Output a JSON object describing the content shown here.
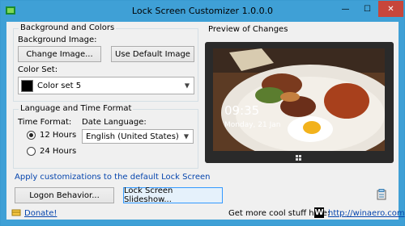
{
  "window": {
    "title": "Lock Screen Customizer 1.0.0.0",
    "minimize": "—",
    "maximize": "☐",
    "close": "✕",
    "app_icon": "lock-screen-app-icon"
  },
  "background_group": {
    "legend": "Background and Colors",
    "background_label": "Background Image:",
    "change_image_button": "Change Image...",
    "default_image_button": "Use Default Image",
    "color_set_label": "Color Set:",
    "color_set_value": "Color set 5",
    "color_swatch": "#000000"
  },
  "preview_group": {
    "legend": "Preview of Changes",
    "time": "09:35",
    "date": "Monday, 21 Jan"
  },
  "language_group": {
    "legend": "Language and Time Format",
    "time_format_label": "Time Format:",
    "option_12": "12 Hours",
    "option_24": "24 Hours",
    "selected_time_format": "12 Hours",
    "date_language_label": "Date Language:",
    "date_language_value": "English (United States)"
  },
  "apply_link": "Apply customizations to the default Lock Screen",
  "logon_button": "Logon Behavior...",
  "slideshow_button": "Lock Screen Slideshow...",
  "footer": {
    "donate_link": "Donate!",
    "more_text": "Get more cool stuff here:",
    "site_link": "http://winaero.com",
    "logo_letter": "W"
  },
  "colors": {
    "titlebar": "#3fa0d6",
    "close": "#c7463b",
    "link": "#0645ad"
  }
}
